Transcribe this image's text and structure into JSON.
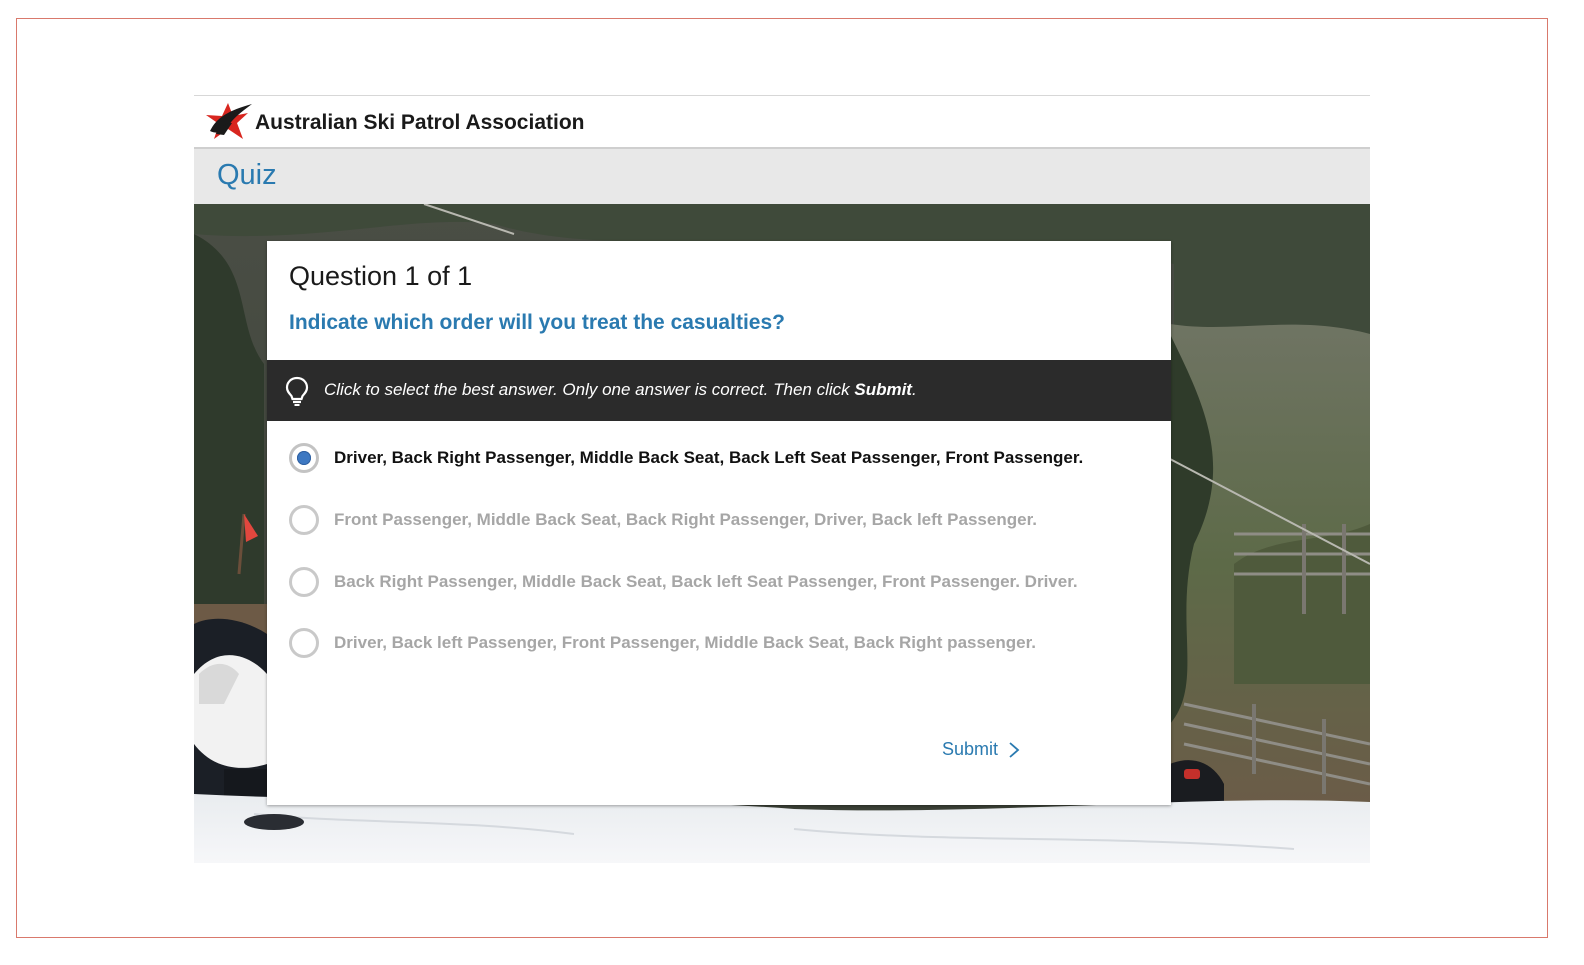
{
  "brand": {
    "name": "Australian Ski Patrol Association",
    "logo_icon": "asp-star-logo-icon"
  },
  "header": {
    "title": "Quiz"
  },
  "quiz": {
    "counter": "Question 1 of 1",
    "question": "Indicate which order will you treat the casualties?",
    "hint": {
      "icon": "lightbulb-icon",
      "text_before": "Click to select the best answer. Only one answer is correct. Then click ",
      "text_bold": "Submit",
      "text_after": "."
    },
    "options": [
      {
        "label": "Driver, Back Right Passenger, Middle Back Seat, Back Left Seat Passenger, Front Passenger.",
        "selected": true
      },
      {
        "label": "Front Passenger, Middle Back Seat, Back Right Passenger, Driver, Back left Passenger.",
        "selected": false
      },
      {
        "label": "Back Right Passenger, Middle Back Seat, Back left Seat Passenger, Front Passenger. Driver.",
        "selected": false
      },
      {
        "label": "Driver, Back left Passenger, Front Passenger, Middle Back Seat, Back Right passenger.",
        "selected": false
      }
    ],
    "submit": {
      "label": "Submit",
      "icon": "chevron-right-icon"
    }
  },
  "colors": {
    "accent": "#2a7ab0",
    "hint_bg": "#2b2b2b",
    "radio_fill": "#3d78c2",
    "frame_border": "#d9796c",
    "unselected_text": "#a6a6a6"
  }
}
